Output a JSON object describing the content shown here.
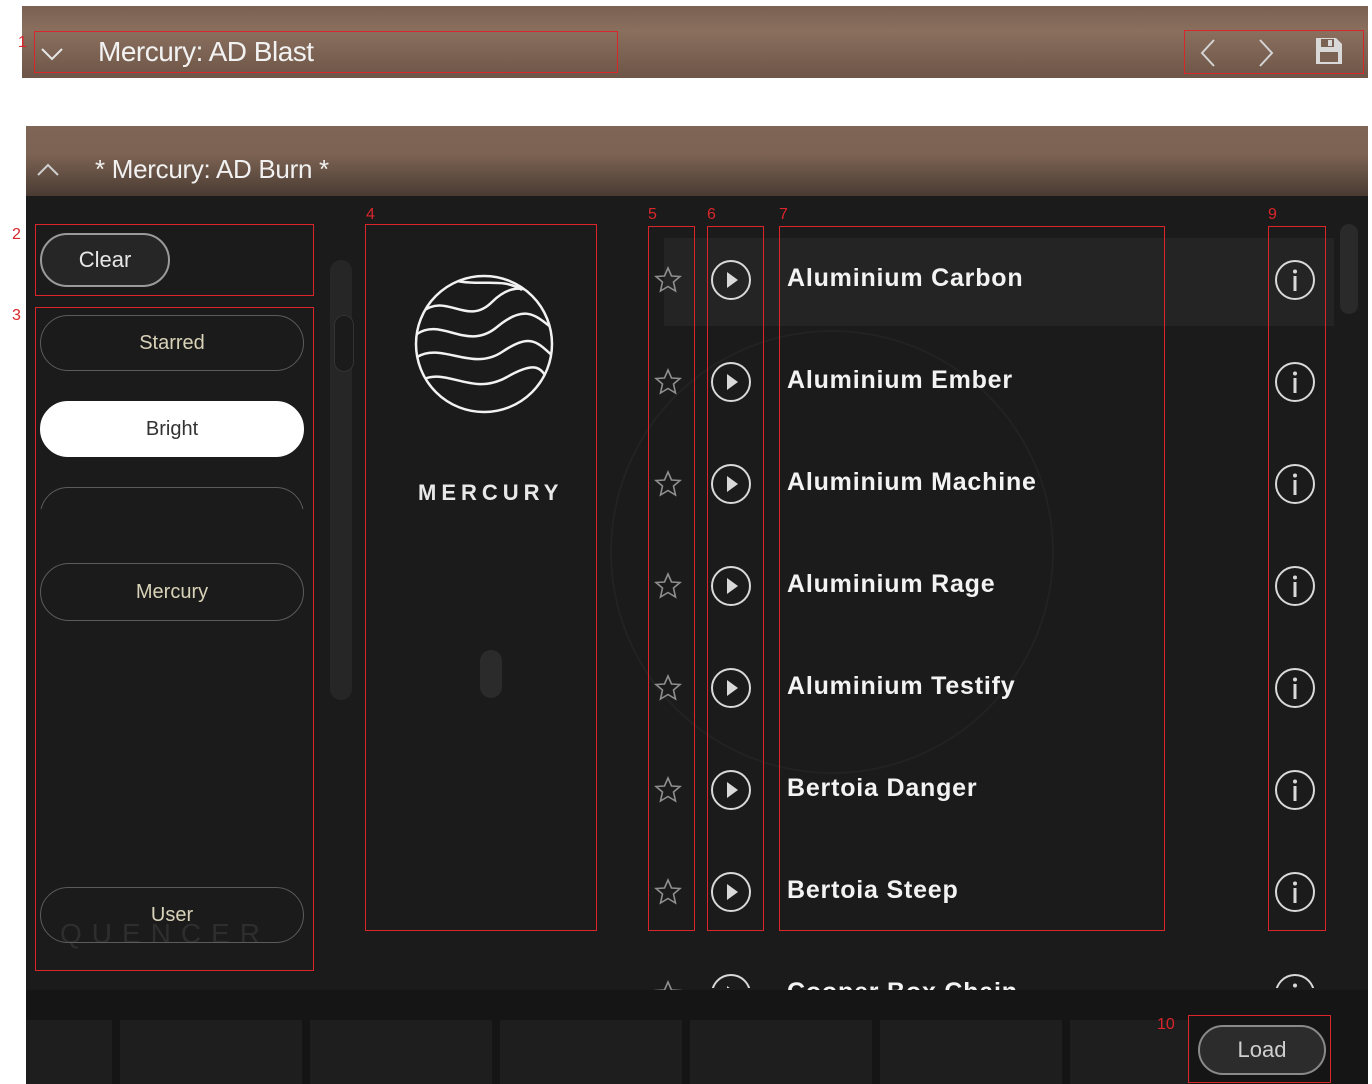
{
  "top_bar": {
    "title": "Mercury: AD Blast",
    "icons": [
      "chevron-down-icon",
      "chevron-left-icon",
      "chevron-right-icon",
      "save-icon"
    ]
  },
  "sub_header": {
    "title": "* Mercury: AD Burn *",
    "icon": "chevron-up-icon"
  },
  "sidebar": {
    "clear_label": "Clear",
    "filters": [
      {
        "label": "Starred",
        "selected": false
      },
      {
        "label": "Bright",
        "selected": true
      },
      {
        "label": "",
        "selected": false
      },
      {
        "label": "Mercury",
        "selected": false
      }
    ],
    "user_label": "User"
  },
  "logo": {
    "text": "MERCURY"
  },
  "presets": [
    {
      "name": "Aluminium Carbon"
    },
    {
      "name": "Aluminium Ember"
    },
    {
      "name": "Aluminium Machine"
    },
    {
      "name": "Aluminium Rage"
    },
    {
      "name": "Aluminium Testify"
    },
    {
      "name": "Bertoia Danger"
    },
    {
      "name": "Bertoia Steep"
    },
    {
      "name": "Cooper Box Chain"
    }
  ],
  "footer": {
    "load_label": "Load"
  },
  "annotations": [
    "1",
    "2",
    "3",
    "4",
    "5",
    "6",
    "7",
    "9",
    "10"
  ],
  "colors": {
    "annotation": "#d8262b",
    "header_brown": "#7b6152",
    "panel_bg": "#1c1b1b",
    "filter_text": "#d8d2b8"
  }
}
